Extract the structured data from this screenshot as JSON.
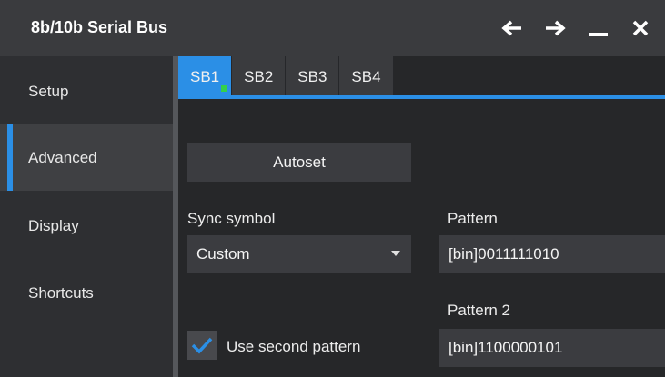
{
  "window": {
    "title": "8b/10b Serial Bus",
    "controls": [
      "arrow-left-icon",
      "arrow-right-icon",
      "minimize-icon",
      "close-icon"
    ]
  },
  "sidebar": {
    "items": [
      {
        "label": "Setup",
        "active": false
      },
      {
        "label": "Advanced",
        "active": true
      },
      {
        "label": "Display",
        "active": false
      },
      {
        "label": "Shortcuts",
        "active": false
      }
    ]
  },
  "tabs": [
    {
      "label": "SB1",
      "active": true,
      "status": "green"
    },
    {
      "label": "SB2",
      "active": false
    },
    {
      "label": "SB3",
      "active": false
    },
    {
      "label": "SB4",
      "active": false
    }
  ],
  "main": {
    "autoset_label": "Autoset",
    "sync_symbol_label": "Sync symbol",
    "sync_symbol_value": "Custom",
    "pattern_label": "Pattern",
    "pattern_value": "[bin]0011111010",
    "pattern2_label": "Pattern 2",
    "pattern2_value": "[bin]1100000101",
    "use_second_label": "Use second pattern",
    "use_second_checked": true
  },
  "colors": {
    "accent": "#2b8fe6",
    "status_green": "#34d04a",
    "titlebar": "#3a3b3e",
    "background": "#262729"
  }
}
